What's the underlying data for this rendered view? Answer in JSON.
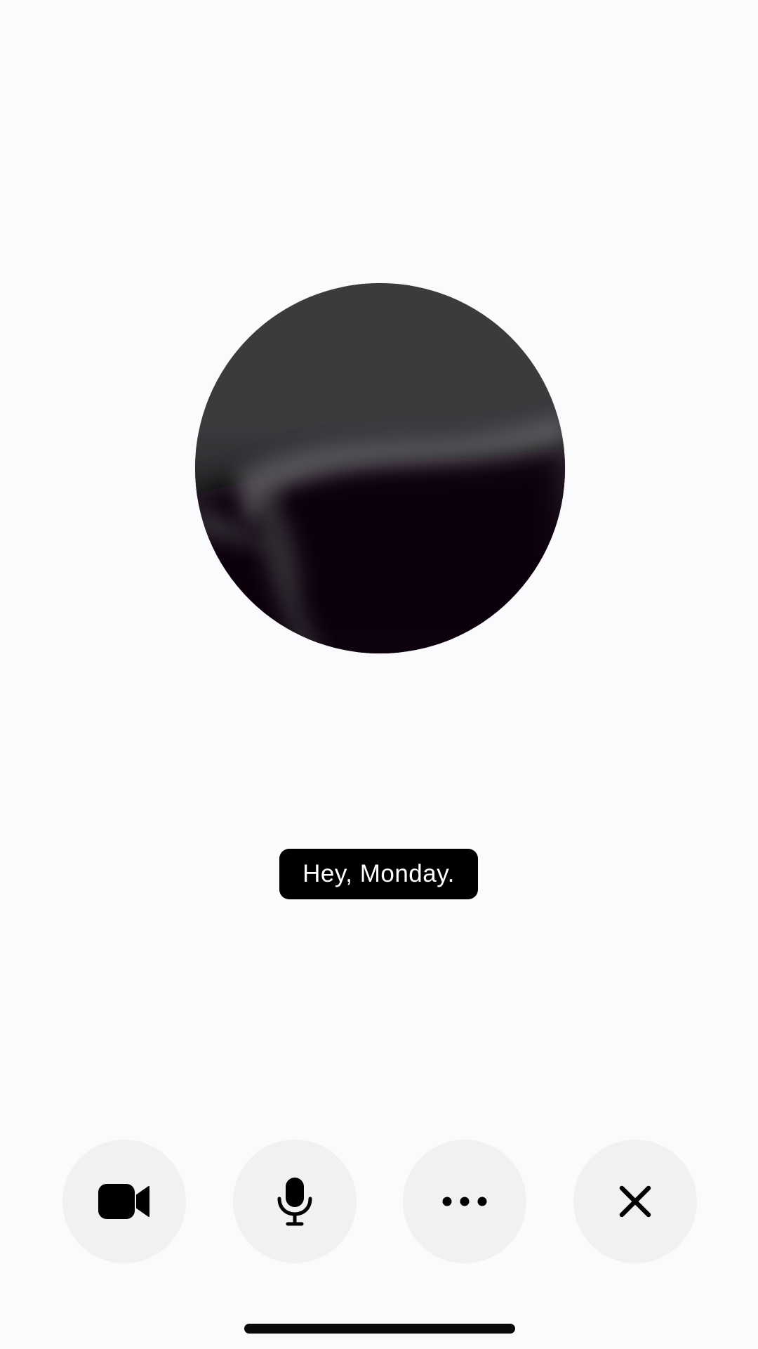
{
  "orb": {
    "icon": "voice-orb",
    "colors": {
      "top": "#3a393c",
      "bottom": "#050406",
      "haze": "#5b5a5e"
    }
  },
  "caption": {
    "text": "Hey, Monday."
  },
  "controls": [
    {
      "name": "camera-button",
      "icon": "video-camera-icon"
    },
    {
      "name": "microphone-button",
      "icon": "microphone-icon"
    },
    {
      "name": "more-button",
      "icon": "ellipsis-icon"
    },
    {
      "name": "close-button",
      "icon": "close-icon"
    }
  ],
  "colors": {
    "background": "#fbfafc",
    "button_bg": "#f1f0f2",
    "icon": "#000000",
    "caption_bg": "#000000",
    "caption_text": "#ffffff"
  }
}
